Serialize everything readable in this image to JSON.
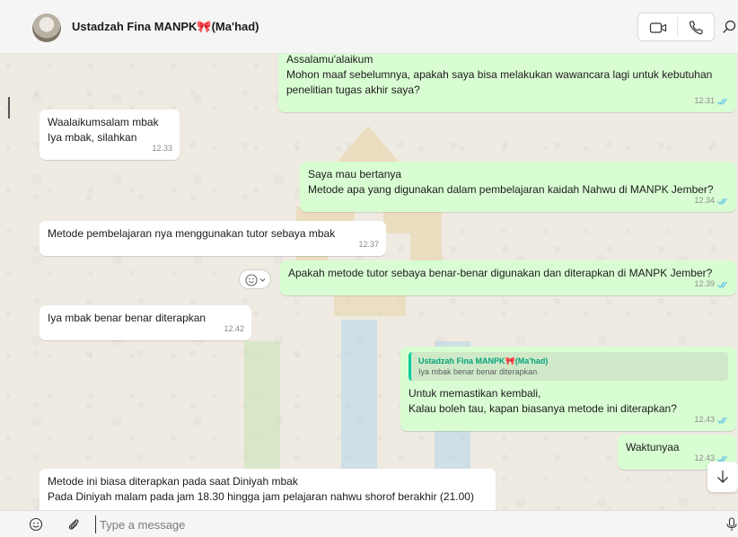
{
  "header": {
    "contact_name": "Ustadzah Fina MANPK🎀(Ma'had)",
    "avatar_icon": "profile-photo",
    "buttons": [
      "video-call-icon",
      "voice-call-icon",
      "search-icon"
    ]
  },
  "colors": {
    "incoming_bubble": "#ffffff",
    "outgoing_bubble": "#d9fdd3",
    "read_ticks": "#53bdeb",
    "quote_accent": "#06cf9c",
    "chat_background": "#efeae2"
  },
  "messages": [
    {
      "direction": "out",
      "text": "Assalamu'alaikum\nMohon maaf sebelumnya, apakah saya bisa melakukan wawancara lagi untuk kebutuhan penelitian tugas akhir saya?",
      "time": "12.31",
      "status": "read"
    },
    {
      "direction": "in",
      "text": "Waalaikumsalam mbak\nIya mbak, silahkan",
      "time": "12.33"
    },
    {
      "direction": "out",
      "text": "Saya mau bertanya\nMetode apa yang digunakan dalam pembelajaran kaidah Nahwu di MANPK Jember?",
      "time": "12.34",
      "status": "read"
    },
    {
      "direction": "in",
      "text": "Metode pembelajaran nya menggunakan tutor sebaya mbak",
      "time": "12.37"
    },
    {
      "direction": "out",
      "text": "Apakah metode tutor sebaya benar-benar digunakan dan diterapkan di MANPK Jember?",
      "time": "12.39",
      "status": "read"
    },
    {
      "direction": "in",
      "text": "Iya mbak benar benar diterapkan",
      "time": "12.42"
    },
    {
      "direction": "out",
      "quote": {
        "author": "Ustadzah Fina MANPK🎀(Ma'had)",
        "text": "Iya mbak benar benar diterapkan"
      },
      "text": "Untuk memastikan kembali,\nKalau boleh tau, kapan biasanya metode ini diterapkan?",
      "time": "12.43",
      "status": "read"
    },
    {
      "direction": "out",
      "text": "Waktunyaa",
      "time": "12.43",
      "status": "read"
    },
    {
      "direction": "in",
      "text": "Metode ini biasa diterapkan pada saat Diniyah mbak\nPada Diniyah malam pada jam 18.30 hingga jam pelajaran nahwu shorof berakhir (21.00)",
      "time": ""
    }
  ],
  "reaction_button": {
    "icon": "smiley-icon",
    "chevron": "chevron-down-icon"
  },
  "scroll_button_icon": "arrow-down-icon",
  "composer": {
    "placeholder": "Type a message",
    "value": "",
    "left_icons": [
      "emoji-icon",
      "paperclip-icon"
    ],
    "right_icon": "microphone-icon"
  }
}
